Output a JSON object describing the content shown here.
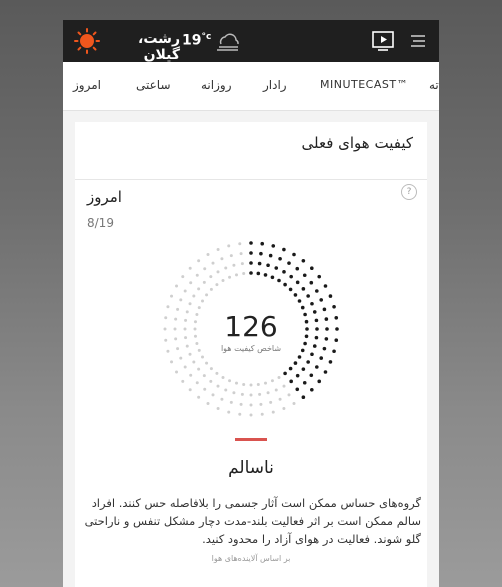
{
  "header": {
    "temperature": "19",
    "temp_unit": "°c",
    "location": "رشت، گیلان",
    "weather_icon": "cloud-icon",
    "sun_icon": "sun-icon",
    "play_icon": "play-icon",
    "menu_icon": "menu-icon"
  },
  "tabs": [
    {
      "label": "امروز"
    },
    {
      "label": "ساعتی"
    },
    {
      "label": "روزانه"
    },
    {
      "label": "رادار"
    },
    {
      "label": "MINUTECAST™"
    },
    {
      "label": "ته"
    }
  ],
  "card": {
    "title": "کیفیت هوای فعلی",
    "help": "?",
    "day_label": "امروز",
    "date": "8/19",
    "aqi_value": "126",
    "aqi_label": "شاخص کیفیت هوا",
    "aqi_fraction": 0.42,
    "status": "ناسالم",
    "description": "گروه‌های حساس ممکن است آثار جسمی را بلافاصله حس کنند. افراد سالم ممکن است بر اثر فعالیت بلند-مدت دچار مشکل تنفس و ناراحتی گلو شوند. فعالیت در هوای آزاد را محدود کنید.",
    "footer": "بر اساس آلاینده‌های هوا"
  },
  "colors": {
    "accent_red": "#d9534f",
    "sun_orange": "#f0561d",
    "topbar": "#1f1f1f"
  }
}
